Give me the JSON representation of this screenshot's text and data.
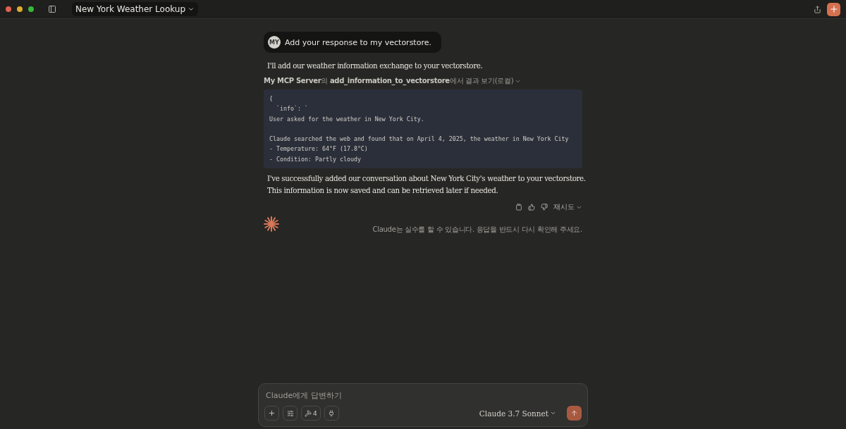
{
  "window": {
    "title": "New York Weather Lookup"
  },
  "user_message": {
    "avatar": "MY",
    "text": "Add your response to my vectorstore."
  },
  "assistant": {
    "intro": "I'll add our weather information exchange to your vectorstore.",
    "tool_call": "**My MCP Server**의 **add_information_to_vectorstore**에서 결과 보기(로컬)",
    "code_paragraphs": [
      [
        "{",
        "  `info`: `",
        "User asked for the weather in New York City."
      ],
      [
        "Claude searched the web and found that on April 4, 2025, the weather in New York City",
        "- Temperature: 64°F (17.8°C)",
        "- Condition: Partly cloudy"
      ]
    ],
    "reply": [
      "I've successfully added our conversation about New York City's weather to your vectorstore.",
      "This information is now saved and can be retrieved later if needed."
    ],
    "retry": "재시도",
    "disclaimer": "Claude는 실수를 할 수 있습니다. 응답을 반드시 다시 확인해 주세요."
  },
  "composer": {
    "placeholder": "Claude에게 답변하기",
    "tools_count": "4",
    "model": "Claude 3.7 Sonnet"
  }
}
